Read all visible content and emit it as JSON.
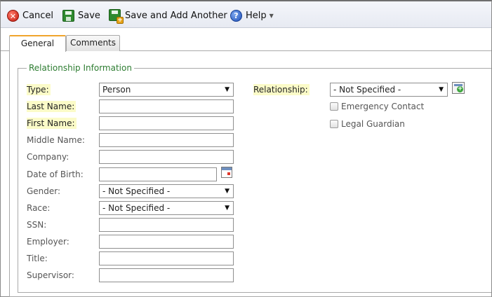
{
  "toolbar": {
    "cancel_label": "Cancel",
    "save_label": "Save",
    "save_add_label": "Save and Add Another",
    "help_label": "Help"
  },
  "tabs": [
    {
      "label": "General",
      "active": true
    },
    {
      "label": "Comments",
      "active": false
    }
  ],
  "section": {
    "legend": "Relationship Information"
  },
  "fields": {
    "type": {
      "label": "Type:",
      "value": "Person"
    },
    "last_name": {
      "label": "Last Name:",
      "value": ""
    },
    "first_name": {
      "label": "First Name:",
      "value": ""
    },
    "middle_name": {
      "label": "Middle Name:",
      "value": ""
    },
    "company": {
      "label": "Company:",
      "value": ""
    },
    "dob": {
      "label": "Date of Birth:",
      "value": ""
    },
    "gender": {
      "label": "Gender:",
      "value": "- Not Specified -"
    },
    "race": {
      "label": "Race:",
      "value": "- Not Specified -"
    },
    "ssn": {
      "label": "SSN:",
      "value": ""
    },
    "employer": {
      "label": "Employer:",
      "value": ""
    },
    "title": {
      "label": "Title:",
      "value": ""
    },
    "supervisor": {
      "label": "Supervisor:",
      "value": ""
    },
    "relationship": {
      "label": "Relationship:",
      "value": "- Not Specified -"
    }
  },
  "checkboxes": {
    "emergency": {
      "label": "Emergency Contact",
      "checked": false
    },
    "guardian": {
      "label": "Legal Guardian",
      "checked": false
    }
  },
  "colors": {
    "required_highlight": "#fbfbc8",
    "legend_text": "#2e7d32",
    "active_tab_accent": "#f0a52c"
  }
}
